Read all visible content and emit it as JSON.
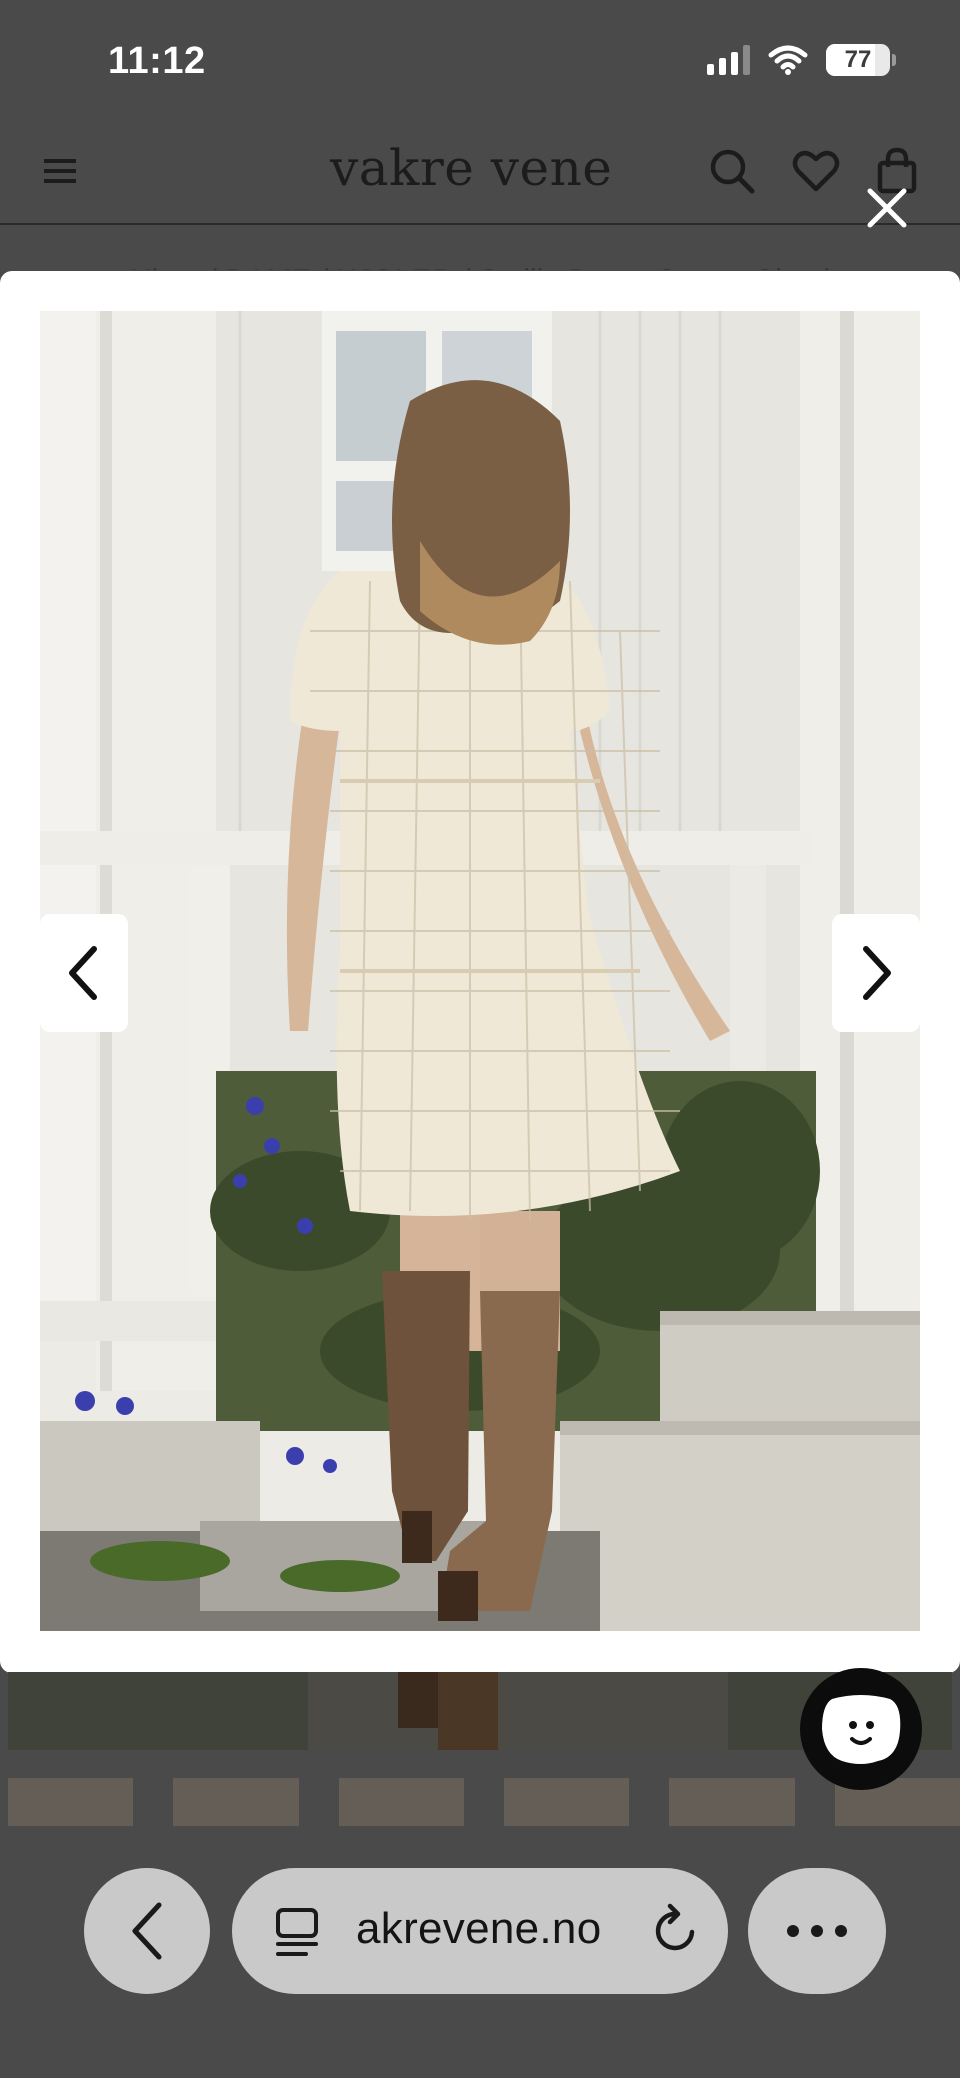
{
  "status_bar": {
    "time": "11:12",
    "battery": "77",
    "battery_fraction": 0.77
  },
  "header": {
    "logo": "vakre vene",
    "icons": [
      "menu-icon",
      "search-icon",
      "heart-icon",
      "bag-icon"
    ]
  },
  "breadcrumb": "Hjem / DAME / KJOLER / Smilla Dress Cream Check",
  "lightbox": {
    "close_icon": "close-icon",
    "prev_icon": "chevron-left-icon",
    "next_icon": "chevron-right-icon",
    "photo_subject": "Woman in cream check tiered dress and brown knee boots, back view, on white porch"
  },
  "chat": {
    "icon": "chat-face-icon"
  },
  "browser": {
    "url": "akrevene.no",
    "back_icon": "chevron-left-icon",
    "tabs_icon": "tabs-icon",
    "reload_icon": "reload-icon",
    "more_icon": "more-icon"
  },
  "colors": {
    "overlay": "#4a4a4a",
    "dress": "#efe8d6",
    "boots": "#7a5a40",
    "pill": "#c9c9c9"
  }
}
